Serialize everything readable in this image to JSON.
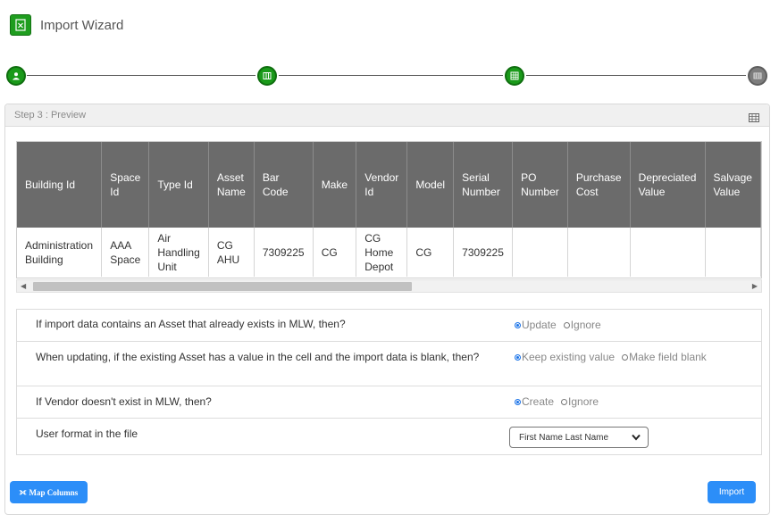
{
  "app": {
    "title": "Import Wizard"
  },
  "stepper": {
    "steps": [
      {
        "state": "done"
      },
      {
        "state": "done"
      },
      {
        "state": "done"
      },
      {
        "state": "pending"
      }
    ]
  },
  "step": {
    "label": "Step 3 : Preview"
  },
  "table": {
    "columns": [
      {
        "key": "building_id",
        "label": "Building Id"
      },
      {
        "key": "space_id",
        "label": "Space Id"
      },
      {
        "key": "type_id",
        "label": "Type Id"
      },
      {
        "key": "asset_name",
        "label": "Asset Name"
      },
      {
        "key": "bar_code",
        "label": "Bar Code"
      },
      {
        "key": "make",
        "label": "Make"
      },
      {
        "key": "vendor_id",
        "label": "Vendor Id"
      },
      {
        "key": "model",
        "label": "Model"
      },
      {
        "key": "serial_number",
        "label": "Serial Number"
      },
      {
        "key": "po_number",
        "label": "PO Number"
      },
      {
        "key": "purchase_cost",
        "label": "Purchase Cost"
      },
      {
        "key": "depreciated_value",
        "label": "Depreciated Value"
      },
      {
        "key": "salvage_value",
        "label": "Salvage Value"
      }
    ],
    "rows": [
      {
        "building_id": "Administration Building",
        "space_id": "AAA Space",
        "type_id": "Air Handling Unit",
        "asset_name": "CG AHU",
        "bar_code": "7309225",
        "make": "CG",
        "vendor_id": "CG Home Depot",
        "model": "CG",
        "serial_number": "7309225",
        "po_number": "",
        "purchase_cost": "",
        "depreciated_value": "",
        "salvage_value": ""
      }
    ]
  },
  "options": {
    "existing_asset": {
      "question": "If import data contains an Asset that already exists in MLW, then?",
      "choices": [
        "Update",
        "Ignore"
      ],
      "selected": "Update"
    },
    "blank_cell": {
      "question": "When updating, if the existing Asset has a value in the cell and the import data is blank, then?",
      "choices": [
        "Keep existing value",
        "Make field blank"
      ],
      "selected": "Keep existing value"
    },
    "vendor_missing": {
      "question": "If Vendor doesn't exist in MLW, then?",
      "choices": [
        "Create",
        "Ignore"
      ],
      "selected": "Create"
    },
    "user_format": {
      "question": "User format in the file",
      "value": "First Name Last Name"
    }
  },
  "buttons": {
    "map_columns": "Map Columns",
    "import": "Import"
  },
  "colors": {
    "accent": "#2c8ef8",
    "step_done": "#1a9a1a",
    "step_pending": "#7d7d7d",
    "header_bg": "#6b6b6b"
  },
  "icons": {
    "app": "spreadsheet-icon",
    "step1": "user-icon",
    "step2": "map-icon",
    "step3": "grid-icon",
    "step4": "table-icon",
    "card": "grid-view-icon"
  }
}
